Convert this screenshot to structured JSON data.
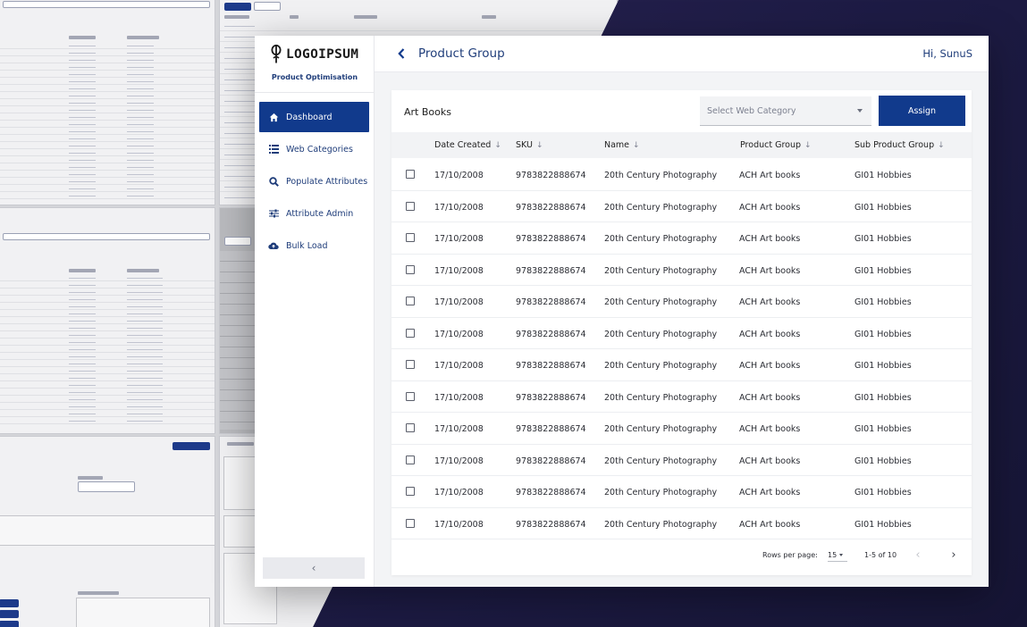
{
  "app": {
    "logo_text": "LOGOIPSUM",
    "subtitle": "Product Optimisation"
  },
  "nav": [
    {
      "label": "Dashboard",
      "icon": "home-icon",
      "active": true
    },
    {
      "label": "Web Categories",
      "icon": "list-icon",
      "active": false
    },
    {
      "label": "Populate Attributes",
      "icon": "search-icon",
      "active": false
    },
    {
      "label": "Attribute Admin",
      "icon": "sliders-icon",
      "active": false
    },
    {
      "label": "Bulk Load",
      "icon": "cloud-upload-icon",
      "active": false
    }
  ],
  "sidebar": {
    "collapse_label": "‹"
  },
  "header": {
    "back_label": "‹",
    "title": "Product Group",
    "greeting": "Hi, SunuS"
  },
  "card": {
    "title": "Art Books",
    "select_placeholder": "Select Web Category",
    "assign_label": "Assign"
  },
  "table": {
    "sort_arrow": "↓",
    "columns": [
      "Date Created",
      "SKU",
      "Name",
      "Product Group",
      "Sub Product Group"
    ],
    "rows": [
      [
        "17/10/2008",
        "9783822888674",
        "20th Century Photography",
        "ACH Art books",
        "GI01 Hobbies"
      ],
      [
        "17/10/2008",
        "9783822888674",
        "20th Century Photography",
        "ACH Art books",
        "GI01 Hobbies"
      ],
      [
        "17/10/2008",
        "9783822888674",
        "20th Century Photography",
        "ACH Art books",
        "GI01 Hobbies"
      ],
      [
        "17/10/2008",
        "9783822888674",
        "20th Century Photography",
        "ACH Art books",
        "GI01 Hobbies"
      ],
      [
        "17/10/2008",
        "9783822888674",
        "20th Century Photography",
        "ACH Art books",
        "GI01 Hobbies"
      ],
      [
        "17/10/2008",
        "9783822888674",
        "20th Century Photography",
        "ACH Art books",
        "GI01 Hobbies"
      ],
      [
        "17/10/2008",
        "9783822888674",
        "20th Century Photography",
        "ACH Art books",
        "GI01 Hobbies"
      ],
      [
        "17/10/2008",
        "9783822888674",
        "20th Century Photography",
        "ACH Art books",
        "GI01 Hobbies"
      ],
      [
        "17/10/2008",
        "9783822888674",
        "20th Century Photography",
        "ACH Art books",
        "GI01 Hobbies"
      ],
      [
        "17/10/2008",
        "9783822888674",
        "20th Century Photography",
        "ACH Art books",
        "GI01 Hobbies"
      ],
      [
        "17/10/2008",
        "9783822888674",
        "20th Century Photography",
        "ACH Art books",
        "GI01 Hobbies"
      ],
      [
        "17/10/2008",
        "9783822888674",
        "20th Century Photography",
        "ACH Art books",
        "GI01 Hobbies"
      ]
    ]
  },
  "pagination": {
    "rows_per_page_label": "Rows per page:",
    "rows_per_page": "15",
    "range": "1-5 of 10",
    "prev_label": "‹",
    "next_label": "›"
  },
  "colors": {
    "primary": "#113a8c",
    "title_text": "#1f3d7a",
    "header_bg": "#f2f3f5"
  }
}
